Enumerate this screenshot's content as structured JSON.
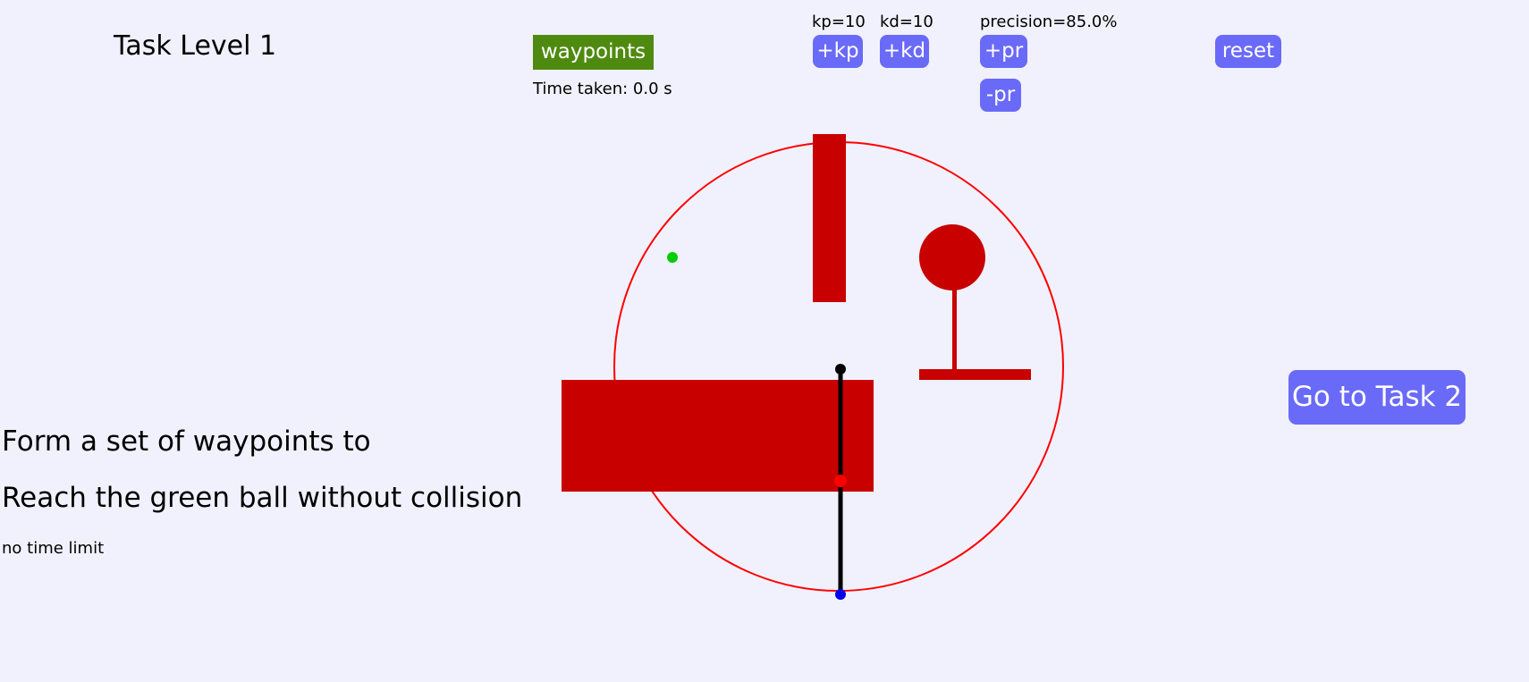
{
  "header": {
    "title": "Task Level 1",
    "mode_button": "waypoints",
    "time_taken": "Time taken: 0.0 s"
  },
  "controls": {
    "kp_text": "kp=10",
    "kd_text": "kd=10",
    "precision_text": "precision=85.0%",
    "kp_plus": "+kp",
    "kd_plus": "+kd",
    "pr_plus": "+pr",
    "pr_minus": "-pr",
    "reset": "reset",
    "next_task": "Go to Task 2"
  },
  "instructions": {
    "line1": "Form a set of waypoints to",
    "line2": "Reach the green ball without collision",
    "note": "no time limit"
  },
  "colors": {
    "background": "#f1f1fd",
    "button": "#6a6af8",
    "mode_button": "#4f8a10",
    "obstacle": "#c80000",
    "boundary": "#ff0000",
    "goal": "#00cc00",
    "arm": "#000000",
    "base_joint": "#0000ee",
    "mid_joint": "#ff0000"
  }
}
